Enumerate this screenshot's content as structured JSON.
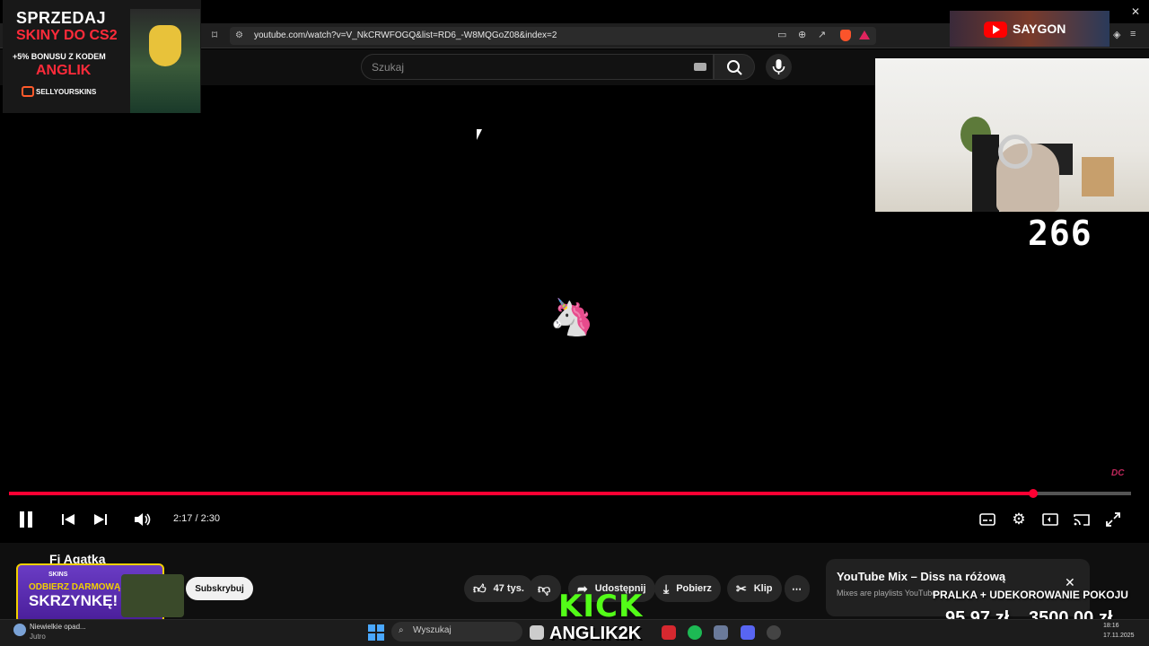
{
  "browser": {
    "url": "youtube.com/watch?v=V_NkCRWFOGQ&list=RD6_-W8MQGoZ08&index=2",
    "close_glyph": "✕"
  },
  "search": {
    "placeholder": "Szukaj"
  },
  "overlay_ad": {
    "line1": "SPRZEDAJ",
    "line2": "SKINY DO CS2",
    "line3": "+5% BONUSU Z KODEM",
    "line4": "ANGLIK",
    "brand": "SELLYOURSKINS"
  },
  "yt_promo": {
    "text": "SAYGON"
  },
  "counter": "266",
  "player": {
    "current_time": "2:17",
    "duration": "2:30",
    "time_display": "2:17 / 2:30",
    "progress_fraction": 0.913,
    "watermark": "DC",
    "center_emoji": "🦄"
  },
  "video": {
    "channel_name": "Fi Agatka",
    "subscribe_label": "Subskrybuj",
    "likes_label": "47 tys.",
    "share_label": "Udostępnij",
    "download_label": "Pobierz",
    "clip_label": "Klip"
  },
  "skins_promo": {
    "brand": "SKINS",
    "line1": "ODBIERZ DARMOWĄ",
    "line2": "SKRZYNKĘ!"
  },
  "mix": {
    "title": "YouTube Mix – Diss na różową",
    "subtitle": "Mixes are playlists YouTube"
  },
  "goal": {
    "title": "PRALKA + UDEKOROWANIE POKOJU",
    "current": "95,97 zł",
    "target": "3500,00 zł"
  },
  "kick": {
    "brand": "KICK",
    "username": "ANGLIK2K"
  },
  "taskbar": {
    "weather_text": "Niewielkie opad...",
    "weather_sub": "Jutro",
    "search_label": "Wyszukaj",
    "time": "18:16",
    "date": "17.11.2025"
  },
  "colors": {
    "accent": "#ff0033",
    "kick_green": "#53fc18",
    "background": "#000000"
  }
}
